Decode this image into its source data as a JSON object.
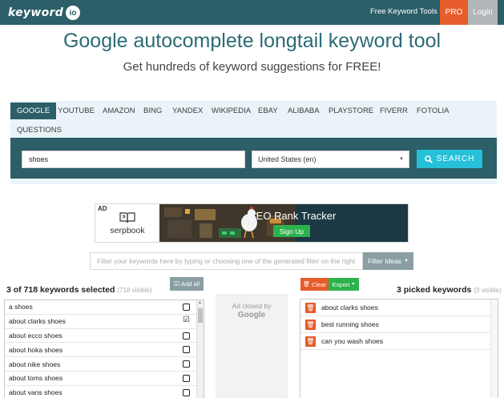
{
  "navbar": {
    "logo_text": "keyword",
    "logo_badge": "io",
    "tools_menu": "Free Keyword Tools",
    "pro_label": "PRO",
    "login_label": "Login"
  },
  "hero": {
    "title": "Google autocomplete longtail keyword tool",
    "subtitle": "Get hundreds of keyword suggestions for FREE!"
  },
  "tabs": [
    {
      "label": "GOOGLE",
      "active": true
    },
    {
      "label": "YOUTUBE"
    },
    {
      "label": "AMAZON"
    },
    {
      "label": "BING"
    },
    {
      "label": "YANDEX"
    },
    {
      "label": "WIKIPEDIA"
    },
    {
      "label": "EBAY"
    },
    {
      "label": "ALIBABA"
    },
    {
      "label": "PLAYSTORE"
    },
    {
      "label": "FIVERR"
    },
    {
      "label": "FOTOLIA"
    },
    {
      "label": "QUESTIONS"
    }
  ],
  "search": {
    "keyword_value": "shoes",
    "country_value": "United States (en)",
    "button_label": "SEARCH"
  },
  "ad_banner": {
    "tag": "AD",
    "brand": "serpbook",
    "headline": "SEO Rank Tracker",
    "cta": "Sign Up"
  },
  "filter": {
    "placeholder": "Filter your keywords here by typing or choosing one of the generated filter on the right",
    "button_label": "Filter Ideas"
  },
  "results": {
    "title": "3 of 718 keywords selected",
    "visible_note": "(718 visible)",
    "add_all_label": "Add all",
    "keywords": [
      {
        "text": "a shoes",
        "checked": false
      },
      {
        "text": "about clarks shoes",
        "checked": true
      },
      {
        "text": "about ecco shoes",
        "checked": false
      },
      {
        "text": "about hoka shoes",
        "checked": false
      },
      {
        "text": "about nike shoes",
        "checked": false
      },
      {
        "text": "about toms shoes",
        "checked": false
      },
      {
        "text": "about vans shoes",
        "checked": false
      }
    ]
  },
  "ad_closed": {
    "text": "Ad closed by",
    "brand": "Google"
  },
  "picked": {
    "title": "3 picked keywords",
    "visible_note": "(3 visible)",
    "clear_label": "Clear",
    "export_label": "Export",
    "keywords": [
      "about clarks shoes",
      "best running shoes",
      "can you wash shoes"
    ]
  },
  "colors": {
    "brand_teal": "#2c5f68",
    "accent_orange": "#e65c2b",
    "search_cyan": "#27c0d9",
    "success_green": "#2bb24c"
  }
}
